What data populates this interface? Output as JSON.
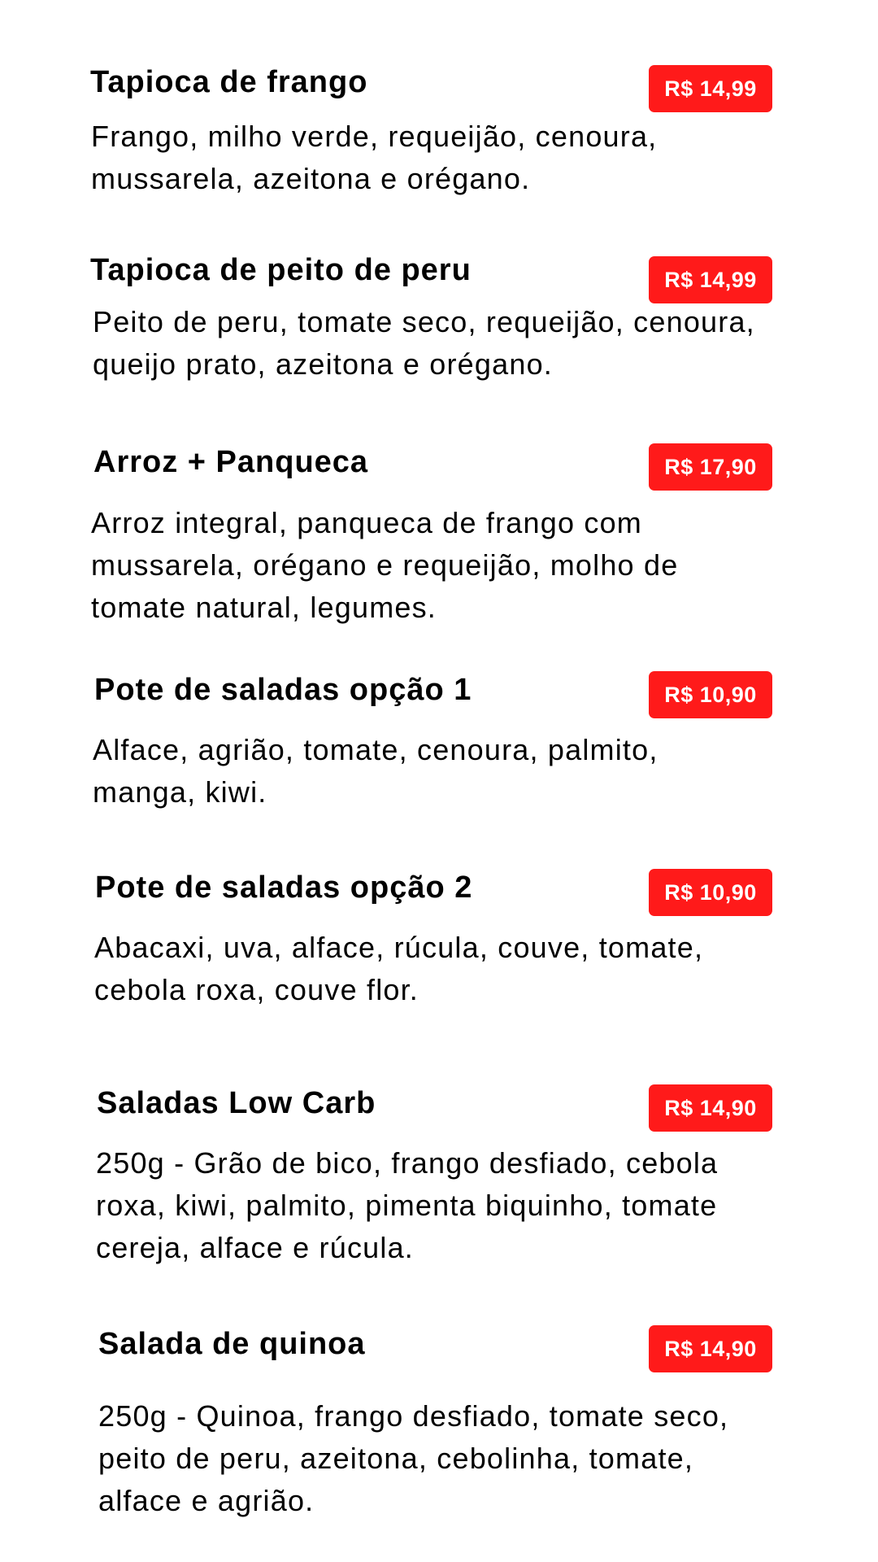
{
  "menu": {
    "items": [
      {
        "name": "Tapioca de frango",
        "price": "R$ 14,99",
        "description": "Frango, milho verde, requeijão, cenoura,\nmussarela, azeitona e orégano."
      },
      {
        "name": "Tapioca de peito de peru",
        "price": "R$ 14,99",
        "description": "Peito de peru, tomate seco, requeijão, cenoura,\nqueijo prato, azeitona e orégano."
      },
      {
        "name": "Arroz + Panqueca",
        "price": "R$ 17,90",
        "description": "Arroz integral, panqueca de frango com\nmussarela, orégano e requeijão, molho de\ntomate natural, legumes."
      },
      {
        "name": "Pote de saladas opção 1",
        "price": "R$ 10,90",
        "description": "Alface, agrião, tomate, cenoura, palmito,\nmanga, kiwi."
      },
      {
        "name": "Pote de saladas opção 2",
        "price": "R$ 10,90",
        "description": "Abacaxi, uva, alface, rúcula, couve, tomate,\ncebola roxa, couve flor."
      },
      {
        "name": "Saladas Low Carb",
        "price": "R$ 14,90",
        "description": "250g - Grão de bico, frango desfiado, cebola\nroxa, kiwi, palmito, pimenta biquinho, tomate\ncereja, alface e rúcula."
      },
      {
        "name": "Salada de quinoa",
        "price": "R$ 14,90",
        "description": "250g - Quinoa, frango desfiado, tomate seco,\npeito de peru, azeitona, cebolinha, tomate,\nalface e agrião."
      }
    ],
    "colors": {
      "price_badge_background": "#ff1a1a",
      "price_badge_text": "#ffffff",
      "text": "#000000",
      "background": "#ffffff"
    }
  }
}
